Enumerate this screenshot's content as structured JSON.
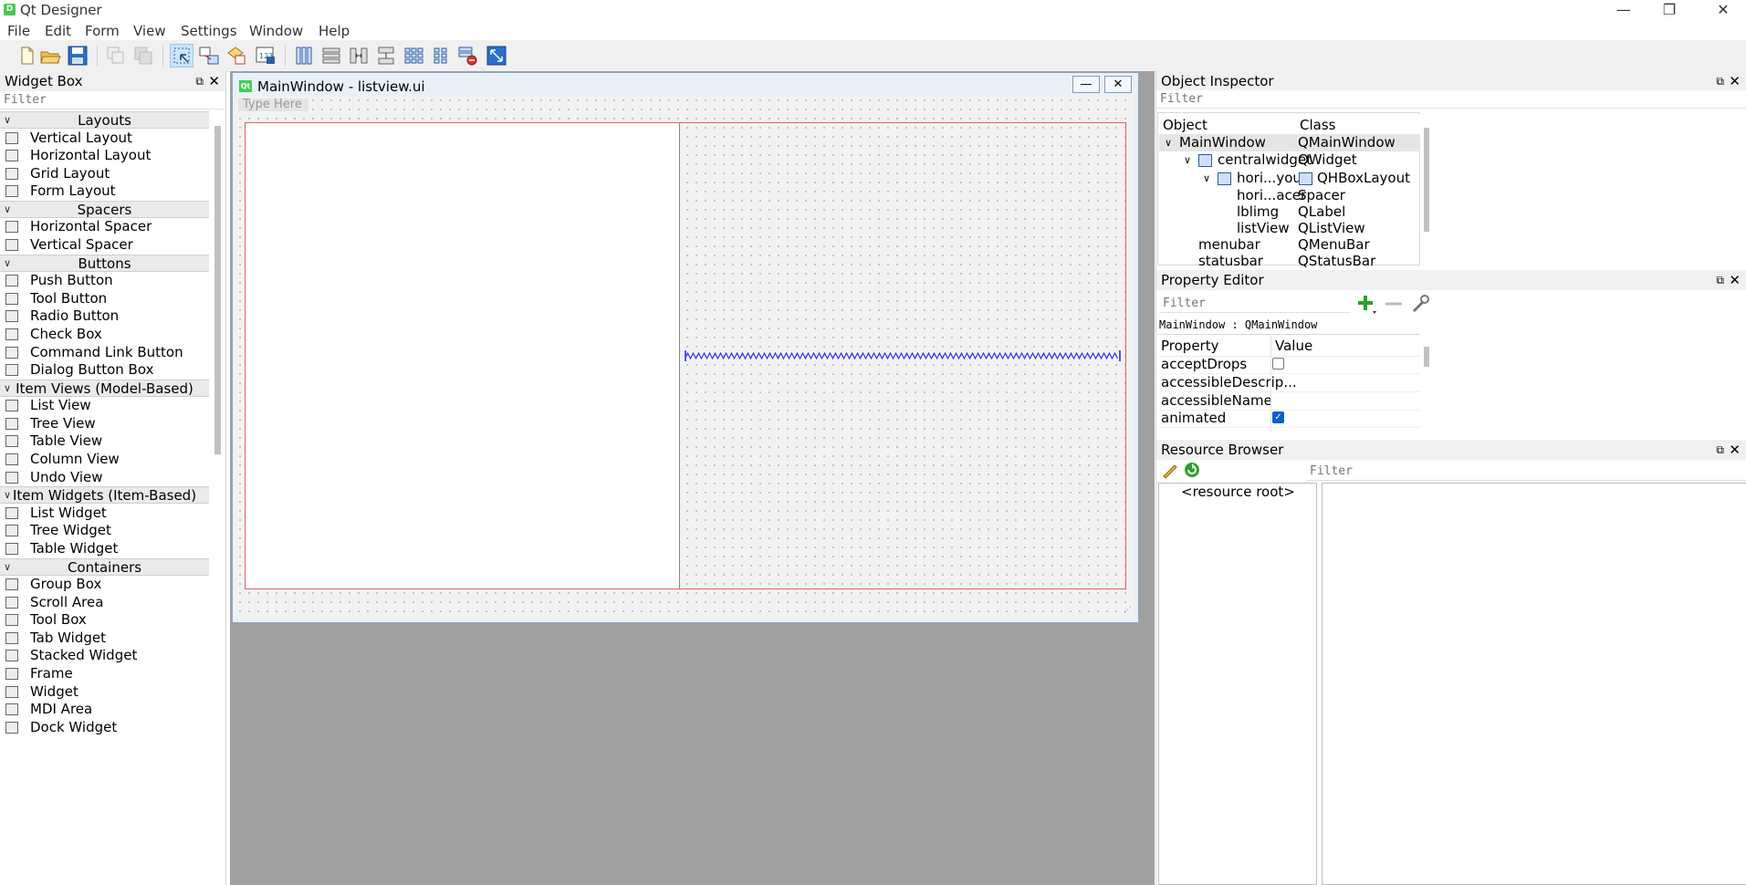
{
  "app": {
    "title": "Qt Designer",
    "icon_text": "D",
    "window_controls": [
      "—",
      "❐",
      "✕"
    ]
  },
  "menu": [
    "File",
    "Edit",
    "Form",
    "View",
    "Settings",
    "Window",
    "Help"
  ],
  "toolbar": {
    "icons": [
      "new-icon",
      "open-icon",
      "save-icon",
      "copy-icon",
      "paste-icon",
      "edit-widgets-icon",
      "edit-signals-slots-icon",
      "edit-buddies-icon",
      "edit-tab-order-icon",
      "lay-out-horizontally-icon",
      "lay-out-vertically-icon",
      "lay-out-horizontal-splitter-icon",
      "lay-out-vertical-splitter-icon",
      "lay-out-grid-icon",
      "lay-out-form-icon",
      "break-layout-icon",
      "adjust-size-icon"
    ]
  },
  "widget_box": {
    "title": "Widget Box",
    "filter_placeholder": "Filter",
    "categories": [
      {
        "name": "Layouts",
        "items": [
          "Vertical Layout",
          "Horizontal Layout",
          "Grid Layout",
          "Form Layout"
        ]
      },
      {
        "name": "Spacers",
        "items": [
          "Horizontal Spacer",
          "Vertical Spacer"
        ]
      },
      {
        "name": "Buttons",
        "items": [
          "Push Button",
          "Tool Button",
          "Radio Button",
          "Check Box",
          "Command Link Button",
          "Dialog Button Box"
        ]
      },
      {
        "name": "Item Views (Model-Based)",
        "items": [
          "List View",
          "Tree View",
          "Table View",
          "Column View",
          "Undo View"
        ]
      },
      {
        "name": "Item Widgets (Item-Based)",
        "items": [
          "List Widget",
          "Tree Widget",
          "Table Widget"
        ]
      },
      {
        "name": "Containers",
        "items": [
          "Group Box",
          "Scroll Area",
          "Tool Box",
          "Tab Widget",
          "Stacked Widget",
          "Frame",
          "Widget",
          "MDI Area",
          "Dock Widget"
        ]
      }
    ]
  },
  "form_window": {
    "title": "MainWindow - listview.ui",
    "icon_text": "Qt",
    "type_here": "Type Here",
    "minimize": "—",
    "close": "✕"
  },
  "object_inspector": {
    "title": "Object Inspector",
    "filter_placeholder": "Filter",
    "columns": [
      "Object",
      "Class"
    ],
    "rows": [
      {
        "object": "MainWindow",
        "class": "QMainWindow",
        "depth": 0,
        "expander": "v",
        "selected": true
      },
      {
        "object": "centralwidget",
        "class": "QWidget",
        "depth": 1,
        "expander": "v"
      },
      {
        "object": "hori...yout",
        "class": "QHBoxLayout",
        "depth": 2,
        "expander": "v"
      },
      {
        "object": "hori...acer",
        "class": "Spacer",
        "depth": 3
      },
      {
        "object": "lblimg",
        "class": "QLabel",
        "depth": 3
      },
      {
        "object": "listView",
        "class": "QListView",
        "depth": 3
      },
      {
        "object": "menubar",
        "class": "QMenuBar",
        "depth": 1
      },
      {
        "object": "statusbar",
        "class": "QStatusBar",
        "depth": 1
      }
    ]
  },
  "property_editor": {
    "title": "Property Editor",
    "filter_placeholder": "Filter",
    "context": "MainWindow : QMainWindow",
    "columns": [
      "Property",
      "Value"
    ],
    "rows": [
      {
        "name": "acceptDrops",
        "checkbox": true,
        "checked": false
      },
      {
        "name": "accessibleDescrip...",
        "checkbox": false
      },
      {
        "name": "accessibleName",
        "checkbox": false
      },
      {
        "name": "animated",
        "checkbox": true,
        "checked": true
      }
    ]
  },
  "resource_browser": {
    "title": "Resource Browser",
    "filter_placeholder": "Filter",
    "root": "<resource root>"
  },
  "colors": {
    "accent": "#0a5fc7",
    "layout_frame": "#e36060",
    "spacer": "#1a1aff",
    "qt_green": "#41cd52"
  }
}
